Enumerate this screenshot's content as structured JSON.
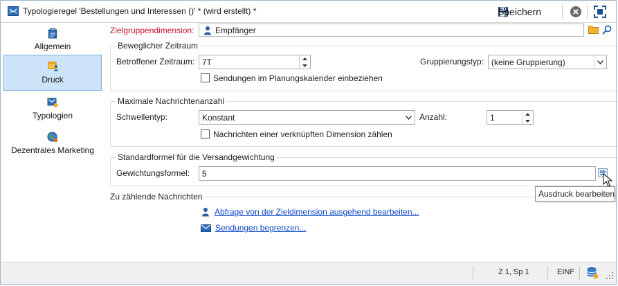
{
  "window": {
    "title": "Typologieregel 'Bestellungen und Interessen ()' * (wird erstellt) *",
    "save_label": "Speichern"
  },
  "sidebar": {
    "items": [
      {
        "label": "Allgemein",
        "icon": "clipboard-icon",
        "active": false
      },
      {
        "label": "Druck",
        "icon": "calendar-person-icon",
        "active": true
      },
      {
        "label": "Typologien",
        "icon": "typology-icon",
        "active": false
      },
      {
        "label": "Dezentrales Marketing",
        "icon": "globe-icon",
        "active": false
      }
    ]
  },
  "target": {
    "label": "Zielgruppendimension:",
    "value": "Empfänger"
  },
  "period": {
    "title": "Beweglicher Zeitraum",
    "period_label": "Betroffener Zeitraum:",
    "period_value": "7T",
    "grouping_label": "Gruppierungstyp:",
    "grouping_value": "(keine Gruppierung)",
    "planning_checkbox_label": "Sendungen im Planungskalender einbeziehen",
    "planning_checked": false
  },
  "max_messages": {
    "title": "Maximale Nachrichtenanzahl",
    "threshold_label": "Schwellentyp:",
    "threshold_value": "Konstant",
    "count_label": "Anzahl:",
    "count_value": "1",
    "linked_checkbox_label": "Nachrichten einer verknüpften Dimension zählen",
    "linked_checked": false
  },
  "weighting": {
    "title": "Standardformel für die Versandgewichtung",
    "formula_label": "Gewichtungsformel:",
    "formula_value": "5",
    "tooltip": "Ausdruck bearbeiten"
  },
  "counted": {
    "title": "Zu zählende Nachrichten",
    "link_query": "Abfrage von der Zieldimension ausgehend bearbeiten...",
    "link_limit": "Sendungen begrenzen..."
  },
  "status": {
    "position": "Z 1, Sp 1",
    "mode": "EINF"
  },
  "colors": {
    "accent": "#0b47c7",
    "required_label": "#c8102e",
    "active_nav": "#cde3f7"
  }
}
